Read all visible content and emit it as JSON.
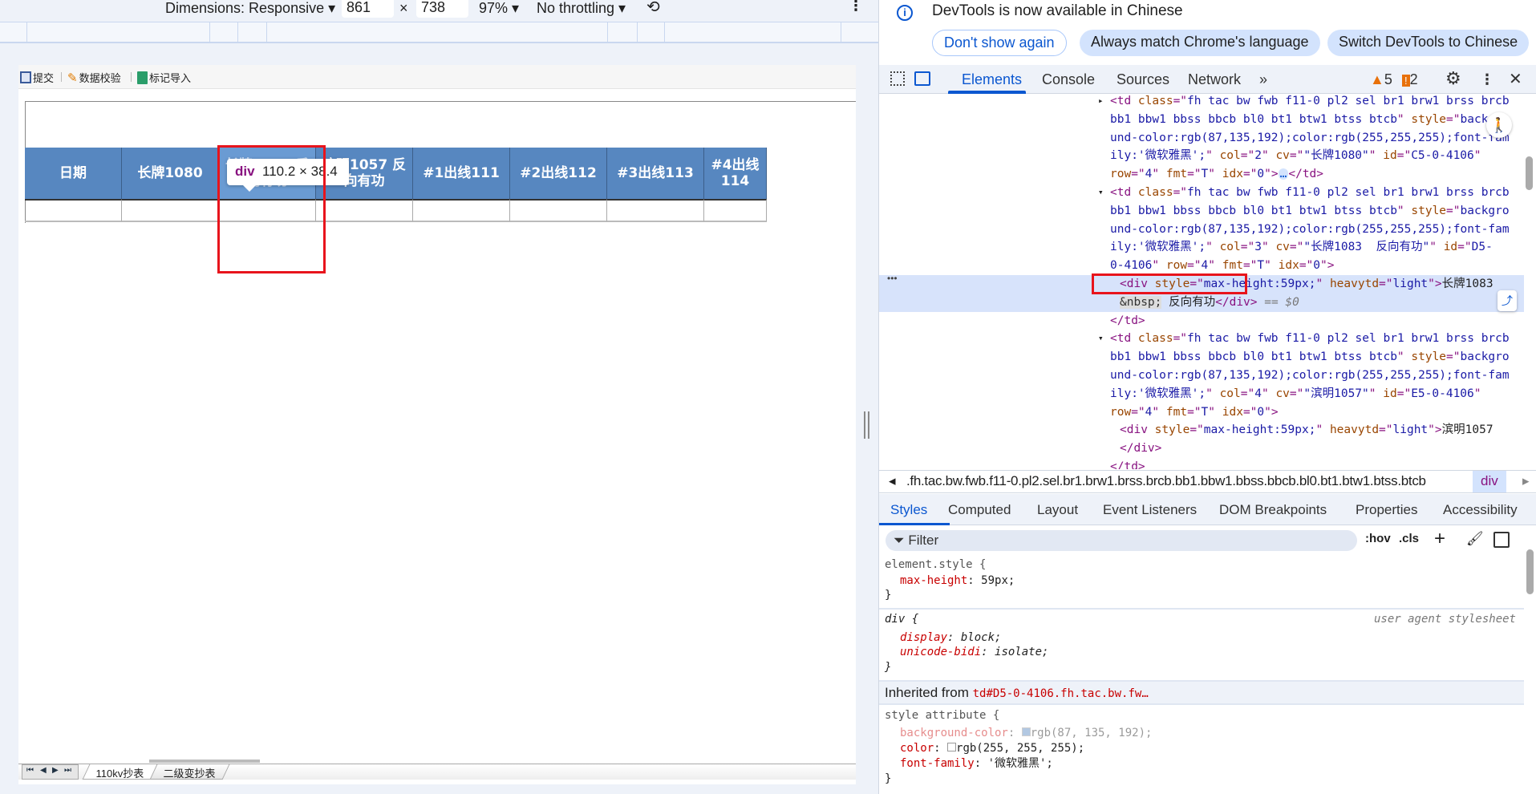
{
  "device_toolbar": {
    "dimensions_label": "Dimensions: Responsive ▾",
    "width": "861",
    "times": "×",
    "height": "738",
    "zoom": "97% ▾",
    "throttling": "No throttling ▾"
  },
  "page": {
    "toolbar": [
      {
        "label": "提交",
        "icon": "save-icon"
      },
      {
        "label": "数据校验",
        "icon": "pencil-icon"
      },
      {
        "label": "标记导入",
        "icon": "excel-import-icon"
      }
    ],
    "headers": [
      "日期",
      "长牌1080",
      "长牌1083  反向有功",
      "滨明1057  反向有功",
      "#1出线111",
      "#2出线112",
      "#3出线113",
      "#4出线114"
    ],
    "tooltip": {
      "tag": "div",
      "size": "110.2 × 38.4"
    },
    "sheet_nav": [
      "⏮",
      "◀",
      "▶",
      "⏭"
    ],
    "sheets": [
      "110kv抄表",
      "二级变抄表"
    ]
  },
  "devtools": {
    "banner": {
      "message": "DevTools is now available in Chinese",
      "buttons": [
        "Don't show again",
        "Always match Chrome's language",
        "Switch DevTools to Chinese"
      ]
    },
    "tabs": [
      "Elements",
      "Console",
      "Sources",
      "Network",
      "»"
    ],
    "warnings": "5",
    "issues": "2",
    "dom_lines": [
      {
        "arrow": "▸",
        "indent": 0,
        "segs": [
          [
            "t",
            "<td "
          ],
          [
            "a",
            "class"
          ],
          [
            "t",
            "=\""
          ],
          [
            "v",
            "fh tac bw fwb f11-0 pl2 sel br1 brw1 brss brcb"
          ]
        ]
      },
      {
        "indent": 0,
        "segs": [
          [
            "v",
            "bb1 bbw1 bbss bbcb bl0 bt1 btw1 btss btcb"
          ],
          [
            "t",
            "\" "
          ],
          [
            "a",
            "style"
          ],
          [
            "t",
            "=\""
          ],
          [
            "v",
            "backgro"
          ]
        ]
      },
      {
        "indent": 0,
        "segs": [
          [
            "v",
            "und-color:rgb(87,135,192);color:rgb(255,255,255);font-fam"
          ]
        ]
      },
      {
        "indent": 0,
        "segs": [
          [
            "v",
            "ily:'微软雅黑';"
          ],
          [
            "t",
            "\" "
          ],
          [
            "a",
            "col"
          ],
          [
            "t",
            "=\""
          ],
          [
            "v",
            "2"
          ],
          [
            "t",
            "\" "
          ],
          [
            "a",
            "cv"
          ],
          [
            "t",
            "=\""
          ],
          [
            "v",
            "\"长牌1080\""
          ],
          [
            "t",
            "\" "
          ],
          [
            "a",
            "id"
          ],
          [
            "t",
            "=\""
          ],
          [
            "v",
            "C5-0-4106"
          ],
          [
            "t",
            "\""
          ]
        ]
      },
      {
        "indent": 0,
        "segs": [
          [
            "a",
            "row"
          ],
          [
            "t",
            "=\""
          ],
          [
            "v",
            "4"
          ],
          [
            "t",
            "\" "
          ],
          [
            "a",
            "fmt"
          ],
          [
            "t",
            "=\""
          ],
          [
            "v",
            "T"
          ],
          [
            "t",
            "\" "
          ],
          [
            "a",
            "idx"
          ],
          [
            "t",
            "=\""
          ],
          [
            "v",
            "0"
          ],
          [
            "t",
            "\">"
          ],
          [
            "g",
            "…"
          ],
          [
            "t",
            "</td>"
          ]
        ]
      },
      {
        "arrow": "▾",
        "indent": 0,
        "segs": [
          [
            "t",
            "<td "
          ],
          [
            "a",
            "class"
          ],
          [
            "t",
            "=\""
          ],
          [
            "v",
            "fh tac bw fwb f11-0 pl2 sel br1 brw1 brss brcb"
          ]
        ]
      },
      {
        "indent": 0,
        "segs": [
          [
            "v",
            "bb1 bbw1 bbss bbcb bl0 bt1 btw1 btss btcb"
          ],
          [
            "t",
            "\" "
          ],
          [
            "a",
            "style"
          ],
          [
            "t",
            "=\""
          ],
          [
            "v",
            "backgro"
          ]
        ]
      },
      {
        "indent": 0,
        "segs": [
          [
            "v",
            "und-color:rgb(87,135,192);color:rgb(255,255,255);font-fam"
          ]
        ]
      },
      {
        "indent": 0,
        "segs": [
          [
            "v",
            "ily:'微软雅黑';"
          ],
          [
            "t",
            "\" "
          ],
          [
            "a",
            "col"
          ],
          [
            "t",
            "=\""
          ],
          [
            "v",
            "3"
          ],
          [
            "t",
            "\" "
          ],
          [
            "a",
            "cv"
          ],
          [
            "t",
            "=\""
          ],
          [
            "v",
            "\"长牌1083  反向有功\""
          ],
          [
            "t",
            "\" "
          ],
          [
            "a",
            "id"
          ],
          [
            "t",
            "=\""
          ],
          [
            "v",
            "D5-"
          ]
        ]
      },
      {
        "indent": 0,
        "segs": [
          [
            "v",
            "0-4106"
          ],
          [
            "t",
            "\" "
          ],
          [
            "a",
            "row"
          ],
          [
            "t",
            "=\""
          ],
          [
            "v",
            "4"
          ],
          [
            "t",
            "\" "
          ],
          [
            "a",
            "fmt"
          ],
          [
            "t",
            "=\""
          ],
          [
            "v",
            "T"
          ],
          [
            "t",
            "\" "
          ],
          [
            "a",
            "idx"
          ],
          [
            "t",
            "=\""
          ],
          [
            "v",
            "0"
          ],
          [
            "t",
            "\">"
          ]
        ]
      },
      {
        "indent": 1,
        "selected": true,
        "segs": [
          [
            "t",
            "<div "
          ],
          [
            "a",
            "style"
          ],
          [
            "t",
            "=\""
          ],
          [
            "v",
            "max-height:59px;"
          ],
          [
            "t",
            "\" "
          ],
          [
            "a",
            "heavytd"
          ],
          [
            "t",
            "=\""
          ],
          [
            "v",
            "light"
          ],
          [
            "t",
            "\">"
          ],
          [
            "x",
            "长牌1083"
          ]
        ]
      },
      {
        "indent": 1,
        "selected": true,
        "segs": [
          [
            "n",
            "&nbsp;"
          ],
          [
            "x",
            " 反向有功"
          ],
          [
            "t",
            "</div>"
          ],
          [
            "g",
            " == $0"
          ]
        ]
      },
      {
        "indent": 0,
        "segs": [
          [
            "t",
            "</td>"
          ]
        ]
      },
      {
        "arrow": "▾",
        "indent": 0,
        "segs": [
          [
            "t",
            "<td "
          ],
          [
            "a",
            "class"
          ],
          [
            "t",
            "=\""
          ],
          [
            "v",
            "fh tac bw fwb f11-0 pl2 sel br1 brw1 brss brcb"
          ]
        ]
      },
      {
        "indent": 0,
        "segs": [
          [
            "v",
            "bb1 bbw1 bbss bbcb bl0 bt1 btw1 btss btcb"
          ],
          [
            "t",
            "\" "
          ],
          [
            "a",
            "style"
          ],
          [
            "t",
            "=\""
          ],
          [
            "v",
            "backgro"
          ]
        ]
      },
      {
        "indent": 0,
        "segs": [
          [
            "v",
            "und-color:rgb(87,135,192);color:rgb(255,255,255);font-fam"
          ]
        ]
      },
      {
        "indent": 0,
        "segs": [
          [
            "v",
            "ily:'微软雅黑';"
          ],
          [
            "t",
            "\" "
          ],
          [
            "a",
            "col"
          ],
          [
            "t",
            "=\""
          ],
          [
            "v",
            "4"
          ],
          [
            "t",
            "\" "
          ],
          [
            "a",
            "cv"
          ],
          [
            "t",
            "=\""
          ],
          [
            "v",
            "\"滨明1057\""
          ],
          [
            "t",
            "\" "
          ],
          [
            "a",
            "id"
          ],
          [
            "t",
            "=\""
          ],
          [
            "v",
            "E5-0-4106"
          ],
          [
            "t",
            "\""
          ]
        ]
      },
      {
        "indent": 0,
        "segs": [
          [
            "a",
            "row"
          ],
          [
            "t",
            "=\""
          ],
          [
            "v",
            "4"
          ],
          [
            "t",
            "\" "
          ],
          [
            "a",
            "fmt"
          ],
          [
            "t",
            "=\""
          ],
          [
            "v",
            "T"
          ],
          [
            "t",
            "\" "
          ],
          [
            "a",
            "idx"
          ],
          [
            "t",
            "=\""
          ],
          [
            "v",
            "0"
          ],
          [
            "t",
            "\">"
          ]
        ]
      },
      {
        "indent": 1,
        "segs": [
          [
            "t",
            "<div "
          ],
          [
            "a",
            "style"
          ],
          [
            "t",
            "=\""
          ],
          [
            "v",
            "max-height:59px;"
          ],
          [
            "t",
            "\" "
          ],
          [
            "a",
            "heavytd"
          ],
          [
            "t",
            "=\""
          ],
          [
            "v",
            "light"
          ],
          [
            "t",
            "\">"
          ],
          [
            "x",
            "滨明1057"
          ]
        ]
      },
      {
        "indent": 1,
        "segs": [
          [
            "t",
            "</div>"
          ]
        ]
      },
      {
        "indent": 0,
        "segs": [
          [
            "t",
            "</td>"
          ]
        ]
      }
    ],
    "breadcrumb": {
      "path": ".fh.tac.bw.fwb.f11-0.pl2.sel.br1.brw1.brss.brcb.bb1.bbw1.bbss.bbcb.bl0.bt1.btw1.btss.btcb",
      "current": "div"
    },
    "style_tabs": [
      "Styles",
      "Computed",
      "Layout",
      "Event Listeners",
      "DOM Breakpoints",
      "Properties",
      "Accessibility"
    ],
    "filter_placeholder": "Filter",
    "hov": ":hov",
    "cls": ".cls",
    "styles": {
      "element_selector": "element.style {",
      "element_prop": "max-height",
      "element_val": "59px;",
      "close": "}",
      "div_selector": "div {",
      "ua_label": "user agent stylesheet",
      "div_props": [
        [
          "display",
          "block;"
        ],
        [
          "unicode-bidi",
          "isolate;"
        ]
      ],
      "inherited_label": "Inherited from ",
      "inherited_target": "td#D5-0-4106.fh.tac.bw.fw…",
      "attr_selector": "style attribute {",
      "attr_props": [
        [
          "background-color",
          "rgb(87, 135, 192);",
          "#5787c0"
        ],
        [
          "color",
          "rgb(255, 255, 255);",
          "#ffffff"
        ],
        [
          "font-family",
          "'微软雅黑';",
          ""
        ]
      ]
    }
  },
  "colors": {
    "header_bg": "#5787c0",
    "accent": "#0b57d0",
    "highlight": "#e8141c"
  }
}
